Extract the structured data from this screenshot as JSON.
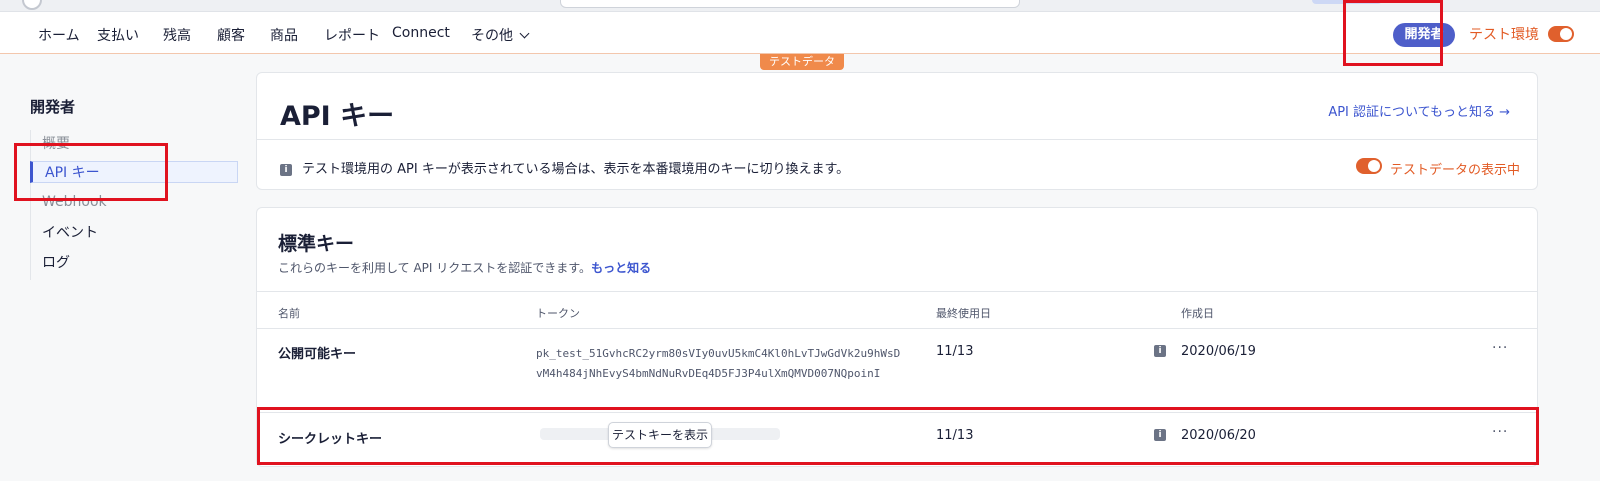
{
  "nav": {
    "items": [
      "ホーム",
      "支払い",
      "残高",
      "顧客",
      "商品",
      "レポート",
      "Connect",
      "その他"
    ],
    "developer_badge": "開発者",
    "test_env_label": "テスト環境",
    "test_data_tag": "テストデータ"
  },
  "sidebar": {
    "title": "開発者",
    "items": [
      {
        "label": "概要",
        "active": false
      },
      {
        "label": "API キー",
        "active": true
      },
      {
        "label": "Webhook",
        "active": false
      },
      {
        "label": "イベント",
        "active": false
      },
      {
        "label": "ログ",
        "active": false
      }
    ]
  },
  "main": {
    "title": "API キー",
    "learn_link": "API 認証についてもっと知る →",
    "notice": "テスト環境用の API キーが表示されている場合は、表示を本番環境用のキーに切り換えます。",
    "test_data_status": "テストデータの表示中",
    "standard_keys": {
      "title": "標準キー",
      "description": "これらのキーを利用して API リクエストを認証できます。",
      "description_link": "もっと知る",
      "columns": [
        "名前",
        "トークン",
        "最終使用日",
        "作成日"
      ],
      "rows": [
        {
          "name": "公開可能キー",
          "token": "pk_test_51GvhcRC2yrm80sVIy0uvU5kmC4Kl0hLvTJwGdVk2u9hWsDvM4h484jNhEvyS4bmNdNuRvDEq4D5FJ3P4ulXmQMVD007NQpoinI",
          "last_used": "11/13",
          "created": "2020/06/19"
        },
        {
          "name": "シークレットキー",
          "reveal_button": "テストキーを表示",
          "last_used": "11/13",
          "created": "2020/06/20"
        }
      ]
    }
  },
  "colors": {
    "accent": "#3c55cf",
    "test_orange": "#e0602d",
    "highlight_red": "#e0121f"
  },
  "icons": [
    "info-icon",
    "chevron-down-icon",
    "more-icon",
    "toggle"
  ]
}
